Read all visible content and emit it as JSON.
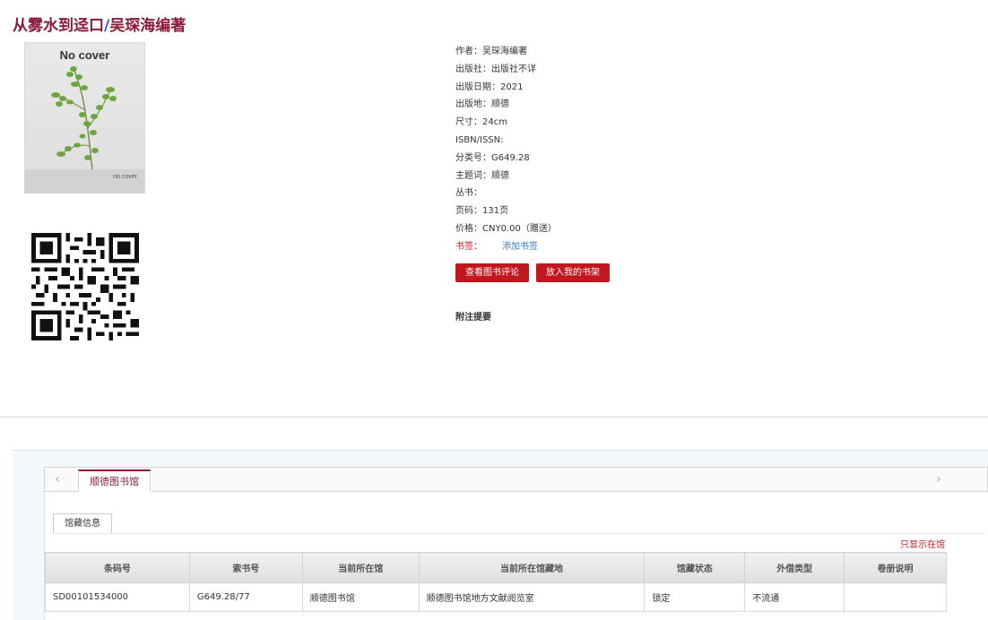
{
  "book": {
    "title_main": "从雾水到迳口",
    "title_sep": "/",
    "title_author": "吴琛海编著"
  },
  "cover": {
    "top_text": "No cover",
    "bottom_text": "no cover"
  },
  "meta": {
    "author": "作者：吴琛海编著",
    "publisher": "出版社：出版社不详",
    "pub_date": "出版日期：2021",
    "pub_place": "出版地：顺德",
    "size": "尺寸：24cm",
    "isbn": "ISBN/ISSN:",
    "class_no": "分类号：G649.28",
    "subject": "主题词：顺德",
    "series": "丛书：",
    "pages": "页码：131页",
    "price": "价格：CNY0.00（赠送）",
    "bookmark_label": "书签：",
    "bookmark_link": "添加书签"
  },
  "buttons": {
    "reviews": "查看图书评论",
    "shelf": "放入我的书架"
  },
  "notes_title": "附注提要",
  "holdings": {
    "library_tab": "顺德图书馆",
    "arrow_left": "‹",
    "arrow_right": "›",
    "sub_tab": "馆藏信息",
    "only_show": "只显示在馆",
    "columns": [
      "条码号",
      "索书号",
      "当前所在馆",
      "当前所在馆藏地",
      "馆藏状态",
      "外借类型",
      "卷册说明"
    ],
    "rows": [
      [
        "SD00101534000",
        "G649.28/77",
        "顺德图书馆",
        "顺德图书馆地方文献阅览室",
        "锁定",
        "不流通",
        ""
      ]
    ]
  },
  "colors": {
    "title": "#8b1a3a",
    "button": "#c1171f",
    "link": "#3a7cc4"
  }
}
